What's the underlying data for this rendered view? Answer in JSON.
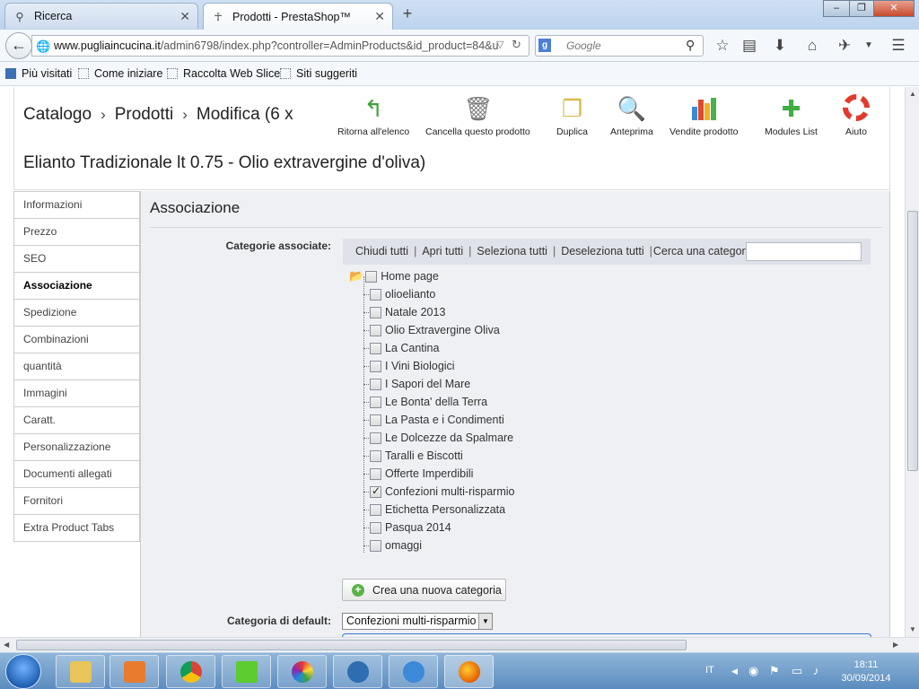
{
  "browser": {
    "tabs": [
      {
        "title": "Ricerca",
        "active": false
      },
      {
        "title": "Prodotti - PrestaShop™",
        "active": true
      }
    ],
    "window_controls": {
      "minimize": "–",
      "maximize": "❐",
      "close": "✕"
    },
    "url_domain": "www.pugliaincucina.it",
    "url_path": "/admin6798/index.php?controller=AdminProducts&id_product=84&u",
    "search_placeholder": "Google",
    "bookmarks": [
      "Più visitati",
      "Come iniziare",
      "Raccolta Web Slice",
      "Siti suggeriti"
    ]
  },
  "header": {
    "breadcrumb": [
      "Catalogo",
      "Prodotti",
      "Modifica (6 x"
    ],
    "product_title": "Elianto Tradizionale lt 0.75 - Olio extravergine d'oliva)",
    "toolbar": [
      {
        "label": "Ritorna all'elenco",
        "icon": "back-arrow-icon"
      },
      {
        "label": "Cancella questo prodotto",
        "icon": "trash-icon"
      },
      {
        "label": "Duplica",
        "icon": "duplicate-icon"
      },
      {
        "label": "Anteprima",
        "icon": "preview-icon"
      },
      {
        "label": "Vendite prodotto",
        "icon": "bar-chart-icon"
      },
      {
        "label": "Modules List",
        "icon": "puzzle-icon"
      },
      {
        "label": "Aiuto",
        "icon": "lifebuoy-icon"
      }
    ]
  },
  "sidebar": {
    "items": [
      "Informazioni",
      "Prezzo",
      "SEO",
      "Associazione",
      "Spedizione",
      "Combinazioni",
      "quantità",
      "Immagini",
      "Caratt.",
      "Personalizzazione",
      "Documenti allegati",
      "Fornitori",
      "Extra Product Tabs"
    ],
    "active": "Associazione"
  },
  "main": {
    "section_title": "Associazione",
    "categories_label": "Categorie associate:",
    "tree_actions": [
      "Chiudi tutti",
      "Apri tutti",
      "Seleziona tutti",
      "Deseleziona tutti"
    ],
    "search_label": "Cerca una categoria :",
    "root": "Home page",
    "categories": [
      {
        "name": "olioelianto",
        "checked": false
      },
      {
        "name": "Natale 2013",
        "checked": false
      },
      {
        "name": "Olio Extravergine Oliva",
        "checked": false
      },
      {
        "name": "La Cantina",
        "checked": false
      },
      {
        "name": "I Vini Biologici",
        "checked": false
      },
      {
        "name": "I Sapori del Mare",
        "checked": false
      },
      {
        "name": "Le Bonta' della Terra",
        "checked": false
      },
      {
        "name": "La Pasta e i Condimenti",
        "checked": false
      },
      {
        "name": "Le Dolcezze da Spalmare",
        "checked": false
      },
      {
        "name": "Taralli e Biscotti",
        "checked": false
      },
      {
        "name": "Offerte Imperdibili",
        "checked": false
      },
      {
        "name": "Confezioni multi-risparmio",
        "checked": true
      },
      {
        "name": "Etichetta Personalizzata",
        "checked": false
      },
      {
        "name": "Pasqua 2014",
        "checked": false
      },
      {
        "name": "omaggi",
        "checked": false
      }
    ],
    "new_category_button": "Crea una nuova categoria",
    "default_category_label": "Categoria di default:",
    "default_category_value": "Confezioni multi-risparmio"
  },
  "taskbar": {
    "language": "IT",
    "time": "18:11",
    "date": "30/09/2014"
  },
  "colors": {
    "accent_green": "#5bb34a",
    "panel_bg": "#eef0f4",
    "taskbar": "#5b8cbf"
  }
}
